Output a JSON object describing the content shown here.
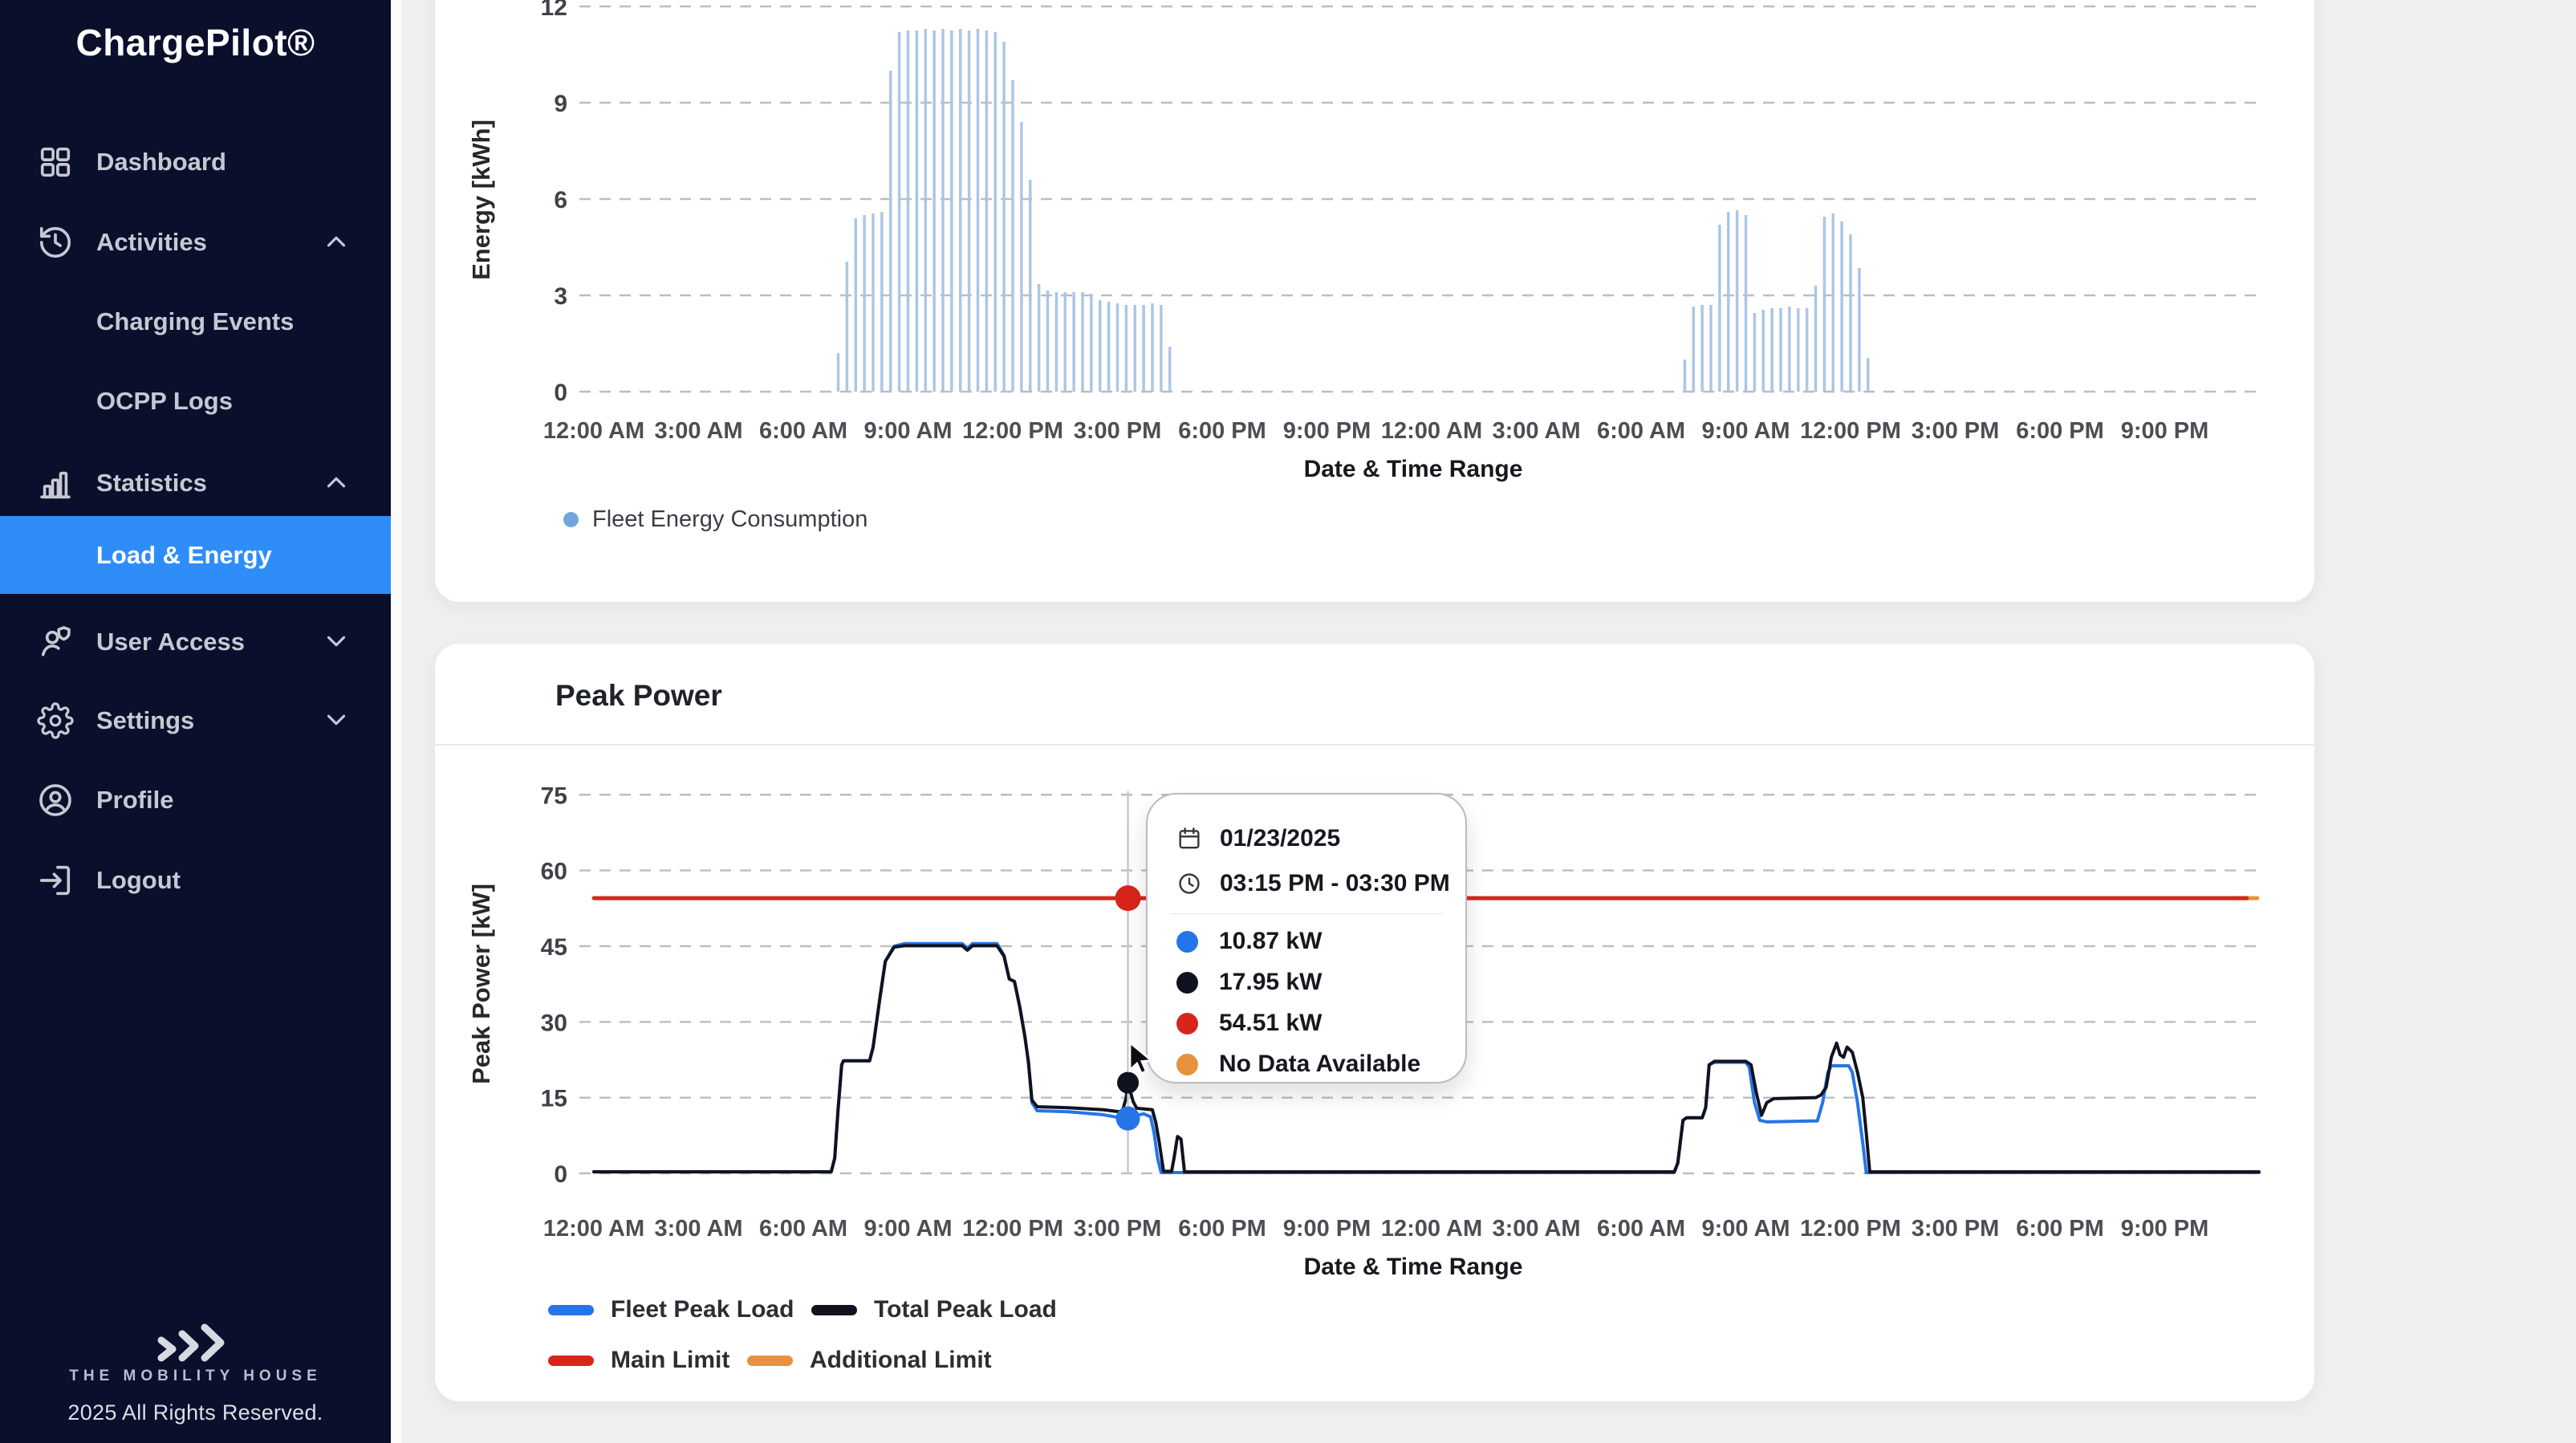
{
  "sidebar": {
    "logo": "ChargePilot®",
    "items": [
      {
        "label": "Dashboard"
      },
      {
        "label": "Activities"
      },
      {
        "label": "Charging Events"
      },
      {
        "label": "OCPP Logs"
      },
      {
        "label": "Statistics"
      },
      {
        "label": "Load & Energy"
      },
      {
        "label": "User Access"
      },
      {
        "label": "Settings"
      },
      {
        "label": "Profile"
      },
      {
        "label": "Logout"
      }
    ],
    "footer": {
      "brand": "THE MOBILITY HOUSE",
      "copyright": "2025 All Rights Reserved."
    }
  },
  "colors": {
    "sidebar_bg": "#0a0f2c",
    "active_item_blue": "#2f8df9",
    "fleet_peak_blue": "#2575e8",
    "total_peak_black": "#10131f",
    "main_limit_red": "#d8251c",
    "additional_limit_orange": "#e8913f",
    "energy_bar_blue": "#a8c3e6",
    "energy_legend_dot": "#72a5da"
  },
  "tooltip": {
    "date": "01/23/2025",
    "time_range": "03:15 PM - 03:30 PM",
    "rows": [
      {
        "color": "#2575e8",
        "label": "10.87 kW"
      },
      {
        "color": "#10131f",
        "label": "17.95 kW"
      },
      {
        "color": "#d8251c",
        "label": "54.51 kW"
      },
      {
        "color": "#e8913f",
        "label": "No Data Available"
      }
    ]
  },
  "chart_data": [
    {
      "id": "energy",
      "type": "bar",
      "title": "",
      "ylabel": "Energy [kWh]",
      "xlabel": "Date & Time Range",
      "ylim": [
        0,
        12
      ],
      "yticks": [
        0,
        3,
        6,
        9,
        12
      ],
      "grid": true,
      "xtick_hours": [
        0,
        3,
        6,
        9,
        12,
        15,
        18,
        21,
        24,
        27,
        30,
        33,
        36,
        39,
        42,
        45
      ],
      "xtick_labels": [
        "12:00 AM",
        "3:00 AM",
        "6:00 AM",
        "9:00 AM",
        "12:00 PM",
        "3:00 PM",
        "6:00 PM",
        "9:00 PM",
        "12:00 AM",
        "3:00 AM",
        "6:00 AM",
        "9:00 AM",
        "12:00 PM",
        "3:00 PM",
        "6:00 PM",
        "9:00 PM"
      ],
      "legend": [
        {
          "label": "Fleet Energy Consumption",
          "color": "#72a5da"
        }
      ],
      "bar_color": "#a8c3e6",
      "bars": [
        [
          7.0,
          1.2
        ],
        [
          7.25,
          4.05
        ],
        [
          7.5,
          5.4
        ],
        [
          7.75,
          5.5
        ],
        [
          8.0,
          5.55
        ],
        [
          8.25,
          5.6
        ],
        [
          8.5,
          10.0
        ],
        [
          8.75,
          11.2
        ],
        [
          9.0,
          11.25
        ],
        [
          9.25,
          11.25
        ],
        [
          9.5,
          11.3
        ],
        [
          9.75,
          11.25
        ],
        [
          10.0,
          11.3
        ],
        [
          10.25,
          11.25
        ],
        [
          10.5,
          11.3
        ],
        [
          10.75,
          11.25
        ],
        [
          11.0,
          11.3
        ],
        [
          11.25,
          11.25
        ],
        [
          11.5,
          11.2
        ],
        [
          11.75,
          10.9
        ],
        [
          12.0,
          9.7
        ],
        [
          12.25,
          8.4
        ],
        [
          12.5,
          6.6
        ],
        [
          12.75,
          3.35
        ],
        [
          13.0,
          3.15
        ],
        [
          13.25,
          3.1
        ],
        [
          13.5,
          3.1
        ],
        [
          13.75,
          3.1
        ],
        [
          14.0,
          3.1
        ],
        [
          14.25,
          3.05
        ],
        [
          14.5,
          2.85
        ],
        [
          14.75,
          2.8
        ],
        [
          15.0,
          2.75
        ],
        [
          15.25,
          2.7
        ],
        [
          15.5,
          2.7
        ],
        [
          15.75,
          2.7
        ],
        [
          16.0,
          2.75
        ],
        [
          16.25,
          2.7
        ],
        [
          16.5,
          1.4
        ],
        [
          31.25,
          1.0
        ],
        [
          31.5,
          2.65
        ],
        [
          31.75,
          2.7
        ],
        [
          32.0,
          2.7
        ],
        [
          32.25,
          5.2
        ],
        [
          32.5,
          5.6
        ],
        [
          32.75,
          5.65
        ],
        [
          33.0,
          5.5
        ],
        [
          33.25,
          2.45
        ],
        [
          33.5,
          2.55
        ],
        [
          33.75,
          2.6
        ],
        [
          34.0,
          2.6
        ],
        [
          34.25,
          2.65
        ],
        [
          34.5,
          2.6
        ],
        [
          34.75,
          2.6
        ],
        [
          35.0,
          3.3
        ],
        [
          35.25,
          5.45
        ],
        [
          35.5,
          5.55
        ],
        [
          35.75,
          5.3
        ],
        [
          36.0,
          4.9
        ],
        [
          36.25,
          3.85
        ],
        [
          36.5,
          1.05
        ]
      ]
    },
    {
      "id": "peak",
      "type": "line",
      "title": "Peak Power",
      "ylabel": "Peak Power [kW]",
      "xlabel": "Date & Time Range",
      "ylim": [
        0,
        80
      ],
      "yticks": [
        0,
        15,
        30,
        45,
        60,
        75
      ],
      "grid": true,
      "xtick_hours": [
        0,
        3,
        6,
        9,
        12,
        15,
        18,
        21,
        24,
        27,
        30,
        33,
        36,
        39,
        42,
        45
      ],
      "xtick_labels": [
        "12:00 AM",
        "3:00 AM",
        "6:00 AM",
        "9:00 AM",
        "12:00 PM",
        "3:00 PM",
        "6:00 PM",
        "9:00 PM",
        "12:00 AM",
        "3:00 AM",
        "6:00 AM",
        "9:00 AM",
        "12:00 PM",
        "3:00 PM",
        "6:00 PM",
        "9:00 PM"
      ],
      "series": [
        {
          "name": "Fleet Peak Load",
          "color": "#2575e8",
          "width": 4,
          "points": [
            [
              0,
              0.3
            ],
            [
              6.8,
              0.3
            ],
            [
              6.9,
              3
            ],
            [
              7.0,
              13
            ],
            [
              7.1,
              21.5
            ],
            [
              7.15,
              22.3
            ],
            [
              7.9,
              22.3
            ],
            [
              8.0,
              25
            ],
            [
              8.2,
              35
            ],
            [
              8.35,
              42
            ],
            [
              8.6,
              45.0
            ],
            [
              8.9,
              45.5
            ],
            [
              10.55,
              45.5
            ],
            [
              10.7,
              44.6
            ],
            [
              10.85,
              45.5
            ],
            [
              11.55,
              45.5
            ],
            [
              11.75,
              43.2
            ],
            [
              11.9,
              38.5
            ],
            [
              12.05,
              38
            ],
            [
              12.2,
              33
            ],
            [
              12.35,
              27
            ],
            [
              12.45,
              22
            ],
            [
              12.55,
              14
            ],
            [
              12.7,
              12.4
            ],
            [
              13.6,
              12.2
            ],
            [
              14.6,
              11.6
            ],
            [
              15.0,
              11.1
            ],
            [
              15.3,
              10.87
            ],
            [
              15.5,
              11.4
            ],
            [
              15.75,
              11.8
            ],
            [
              15.95,
              11.2
            ],
            [
              16.05,
              8
            ],
            [
              16.15,
              3
            ],
            [
              16.25,
              0.15
            ],
            [
              30.95,
              0.15
            ],
            [
              31.05,
              2
            ],
            [
              31.2,
              10.5
            ],
            [
              31.3,
              11
            ],
            [
              31.75,
              11
            ],
            [
              31.85,
              13
            ],
            [
              31.95,
              21.5
            ],
            [
              32.1,
              22.0
            ],
            [
              33.0,
              22.0
            ],
            [
              33.1,
              21
            ],
            [
              33.25,
              14
            ],
            [
              33.4,
              10.5
            ],
            [
              33.6,
              10.2
            ],
            [
              35.05,
              10.4
            ],
            [
              35.2,
              14
            ],
            [
              35.35,
              20
            ],
            [
              35.45,
              21.3
            ],
            [
              35.95,
              21.3
            ],
            [
              36.05,
              20
            ],
            [
              36.2,
              14
            ],
            [
              36.35,
              6
            ],
            [
              36.45,
              0.15
            ],
            [
              47.7,
              0.15
            ]
          ]
        },
        {
          "name": "Total Peak Load",
          "color": "#10131f",
          "width": 4,
          "points": [
            [
              0,
              0.3
            ],
            [
              6.8,
              0.3
            ],
            [
              6.9,
              3
            ],
            [
              7.0,
              13
            ],
            [
              7.1,
              21.5
            ],
            [
              7.15,
              22.3
            ],
            [
              7.9,
              22.3
            ],
            [
              8.0,
              25
            ],
            [
              8.2,
              35
            ],
            [
              8.35,
              42
            ],
            [
              8.6,
              44.8
            ],
            [
              8.9,
              45.1
            ],
            [
              10.55,
              45.1
            ],
            [
              10.7,
              44.2
            ],
            [
              10.85,
              45.1
            ],
            [
              11.55,
              45.1
            ],
            [
              11.75,
              43
            ],
            [
              11.9,
              38.5
            ],
            [
              12.05,
              38
            ],
            [
              12.2,
              33
            ],
            [
              12.35,
              27
            ],
            [
              12.45,
              22
            ],
            [
              12.55,
              14.5
            ],
            [
              12.7,
              13.2
            ],
            [
              13.6,
              13
            ],
            [
              14.6,
              12.6
            ],
            [
              15.05,
              12.2
            ],
            [
              15.15,
              12.5
            ],
            [
              15.25,
              15
            ],
            [
              15.3,
              17.95
            ],
            [
              15.45,
              14.2
            ],
            [
              15.55,
              12.9
            ],
            [
              16.0,
              12.6
            ],
            [
              16.1,
              10
            ],
            [
              16.2,
              6
            ],
            [
              16.32,
              0.4
            ],
            [
              16.55,
              0.4
            ],
            [
              16.62,
              3
            ],
            [
              16.72,
              7.3
            ],
            [
              16.82,
              6.8
            ],
            [
              16.92,
              0.3
            ],
            [
              30.95,
              0.3
            ],
            [
              31.05,
              2
            ],
            [
              31.2,
              10.5
            ],
            [
              31.3,
              11
            ],
            [
              31.75,
              11
            ],
            [
              31.85,
              13
            ],
            [
              31.95,
              21.5
            ],
            [
              32.1,
              22.2
            ],
            [
              33.0,
              22.2
            ],
            [
              33.15,
              21.5
            ],
            [
              33.3,
              16
            ],
            [
              33.45,
              11.5
            ],
            [
              33.6,
              14
            ],
            [
              33.8,
              14.8
            ],
            [
              35.0,
              15
            ],
            [
              35.15,
              15.5
            ],
            [
              35.3,
              17
            ],
            [
              35.45,
              23
            ],
            [
              35.6,
              25.8
            ],
            [
              35.7,
              23.5
            ],
            [
              35.8,
              23
            ],
            [
              35.9,
              25
            ],
            [
              36.05,
              24
            ],
            [
              36.2,
              20
            ],
            [
              36.35,
              15
            ],
            [
              36.45,
              8
            ],
            [
              36.55,
              0.3
            ],
            [
              47.7,
              0.3
            ]
          ]
        },
        {
          "name": "Main Limit",
          "color": "#d8251c",
          "width": 5,
          "points": [
            [
              0,
              54.51
            ],
            [
              47.35,
              54.51
            ]
          ]
        },
        {
          "name": "Additional Limit",
          "color": "#e8913f",
          "width": 5,
          "points": [
            [
              46.9,
              54.51
            ],
            [
              47.65,
              54.51
            ]
          ]
        }
      ],
      "legend_rows": [
        [
          "Fleet Peak Load",
          "Total Peak Load"
        ],
        [
          "Main Limit",
          "Additional Limit"
        ]
      ],
      "crosshair_hour": 15.3,
      "markers": [
        {
          "color": "#2575e8",
          "kw": 10.87,
          "r": 15
        },
        {
          "color": "#10131f",
          "kw": 17.95,
          "r": 13.5
        },
        {
          "color": "#d8251c",
          "kw": 54.51,
          "r": 16
        }
      ]
    }
  ]
}
